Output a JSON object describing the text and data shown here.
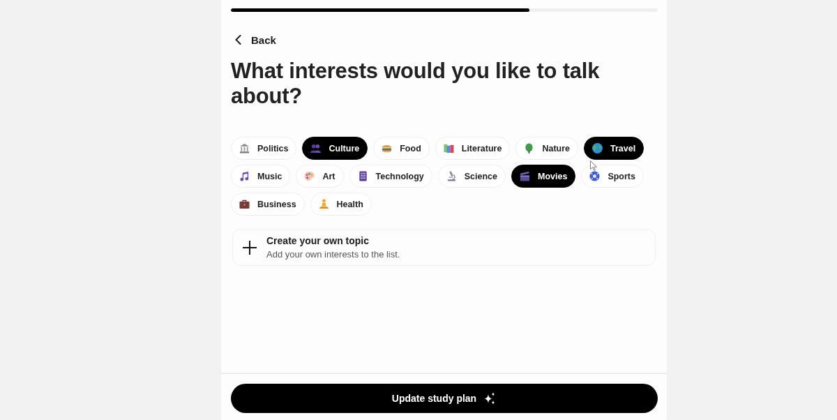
{
  "progress": {
    "level": 0.7
  },
  "back": {
    "label": "Back"
  },
  "title": "What interests would you like to talk about?",
  "topics": [
    {
      "label": "Politics",
      "selected": false
    },
    {
      "label": "Culture",
      "selected": true
    },
    {
      "label": "Food",
      "selected": false
    },
    {
      "label": "Literature",
      "selected": false
    },
    {
      "label": "Nature",
      "selected": false
    },
    {
      "label": "Travel",
      "selected": true
    },
    {
      "label": "Music",
      "selected": false
    },
    {
      "label": "Art",
      "selected": false
    },
    {
      "label": "Technology",
      "selected": false
    },
    {
      "label": "Science",
      "selected": false
    },
    {
      "label": "Movies",
      "selected": true
    },
    {
      "label": "Sports",
      "selected": false
    },
    {
      "label": "Business",
      "selected": false
    },
    {
      "label": "Health",
      "selected": false
    }
  ],
  "create_topic": {
    "title": "Create your own topic",
    "subtitle": "Add your own interests to the list."
  },
  "primary_button": {
    "label": "Update study plan"
  }
}
